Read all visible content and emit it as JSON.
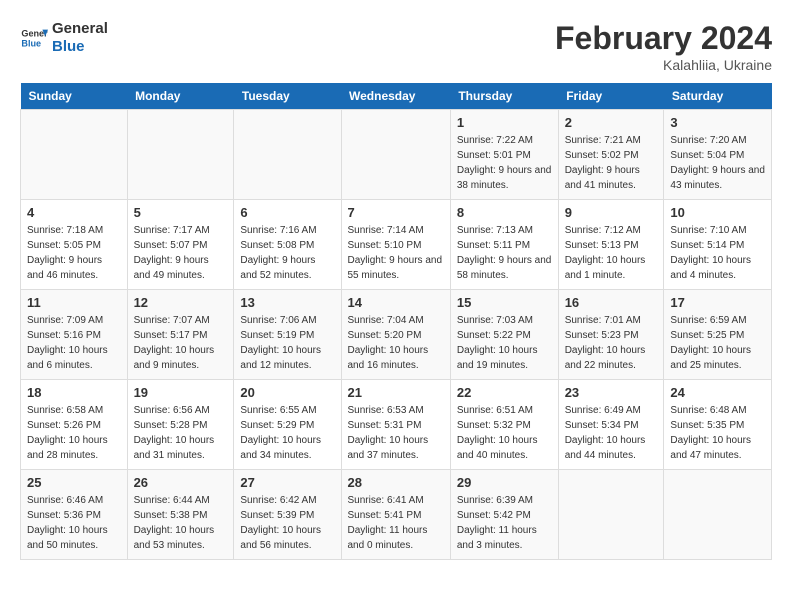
{
  "header": {
    "logo_line1": "General",
    "logo_line2": "Blue",
    "month_title": "February 2024",
    "subtitle": "Kalahliia, Ukraine"
  },
  "days_of_week": [
    "Sunday",
    "Monday",
    "Tuesday",
    "Wednesday",
    "Thursday",
    "Friday",
    "Saturday"
  ],
  "weeks": [
    [
      {
        "day": "",
        "info": ""
      },
      {
        "day": "",
        "info": ""
      },
      {
        "day": "",
        "info": ""
      },
      {
        "day": "",
        "info": ""
      },
      {
        "day": "1",
        "info": "Sunrise: 7:22 AM\nSunset: 5:01 PM\nDaylight: 9 hours and 38 minutes."
      },
      {
        "day": "2",
        "info": "Sunrise: 7:21 AM\nSunset: 5:02 PM\nDaylight: 9 hours and 41 minutes."
      },
      {
        "day": "3",
        "info": "Sunrise: 7:20 AM\nSunset: 5:04 PM\nDaylight: 9 hours and 43 minutes."
      }
    ],
    [
      {
        "day": "4",
        "info": "Sunrise: 7:18 AM\nSunset: 5:05 PM\nDaylight: 9 hours and 46 minutes."
      },
      {
        "day": "5",
        "info": "Sunrise: 7:17 AM\nSunset: 5:07 PM\nDaylight: 9 hours and 49 minutes."
      },
      {
        "day": "6",
        "info": "Sunrise: 7:16 AM\nSunset: 5:08 PM\nDaylight: 9 hours and 52 minutes."
      },
      {
        "day": "7",
        "info": "Sunrise: 7:14 AM\nSunset: 5:10 PM\nDaylight: 9 hours and 55 minutes."
      },
      {
        "day": "8",
        "info": "Sunrise: 7:13 AM\nSunset: 5:11 PM\nDaylight: 9 hours and 58 minutes."
      },
      {
        "day": "9",
        "info": "Sunrise: 7:12 AM\nSunset: 5:13 PM\nDaylight: 10 hours and 1 minute."
      },
      {
        "day": "10",
        "info": "Sunrise: 7:10 AM\nSunset: 5:14 PM\nDaylight: 10 hours and 4 minutes."
      }
    ],
    [
      {
        "day": "11",
        "info": "Sunrise: 7:09 AM\nSunset: 5:16 PM\nDaylight: 10 hours and 6 minutes."
      },
      {
        "day": "12",
        "info": "Sunrise: 7:07 AM\nSunset: 5:17 PM\nDaylight: 10 hours and 9 minutes."
      },
      {
        "day": "13",
        "info": "Sunrise: 7:06 AM\nSunset: 5:19 PM\nDaylight: 10 hours and 12 minutes."
      },
      {
        "day": "14",
        "info": "Sunrise: 7:04 AM\nSunset: 5:20 PM\nDaylight: 10 hours and 16 minutes."
      },
      {
        "day": "15",
        "info": "Sunrise: 7:03 AM\nSunset: 5:22 PM\nDaylight: 10 hours and 19 minutes."
      },
      {
        "day": "16",
        "info": "Sunrise: 7:01 AM\nSunset: 5:23 PM\nDaylight: 10 hours and 22 minutes."
      },
      {
        "day": "17",
        "info": "Sunrise: 6:59 AM\nSunset: 5:25 PM\nDaylight: 10 hours and 25 minutes."
      }
    ],
    [
      {
        "day": "18",
        "info": "Sunrise: 6:58 AM\nSunset: 5:26 PM\nDaylight: 10 hours and 28 minutes."
      },
      {
        "day": "19",
        "info": "Sunrise: 6:56 AM\nSunset: 5:28 PM\nDaylight: 10 hours and 31 minutes."
      },
      {
        "day": "20",
        "info": "Sunrise: 6:55 AM\nSunset: 5:29 PM\nDaylight: 10 hours and 34 minutes."
      },
      {
        "day": "21",
        "info": "Sunrise: 6:53 AM\nSunset: 5:31 PM\nDaylight: 10 hours and 37 minutes."
      },
      {
        "day": "22",
        "info": "Sunrise: 6:51 AM\nSunset: 5:32 PM\nDaylight: 10 hours and 40 minutes."
      },
      {
        "day": "23",
        "info": "Sunrise: 6:49 AM\nSunset: 5:34 PM\nDaylight: 10 hours and 44 minutes."
      },
      {
        "day": "24",
        "info": "Sunrise: 6:48 AM\nSunset: 5:35 PM\nDaylight: 10 hours and 47 minutes."
      }
    ],
    [
      {
        "day": "25",
        "info": "Sunrise: 6:46 AM\nSunset: 5:36 PM\nDaylight: 10 hours and 50 minutes."
      },
      {
        "day": "26",
        "info": "Sunrise: 6:44 AM\nSunset: 5:38 PM\nDaylight: 10 hours and 53 minutes."
      },
      {
        "day": "27",
        "info": "Sunrise: 6:42 AM\nSunset: 5:39 PM\nDaylight: 10 hours and 56 minutes."
      },
      {
        "day": "28",
        "info": "Sunrise: 6:41 AM\nSunset: 5:41 PM\nDaylight: 11 hours and 0 minutes."
      },
      {
        "day": "29",
        "info": "Sunrise: 6:39 AM\nSunset: 5:42 PM\nDaylight: 11 hours and 3 minutes."
      },
      {
        "day": "",
        "info": ""
      },
      {
        "day": "",
        "info": ""
      }
    ]
  ]
}
